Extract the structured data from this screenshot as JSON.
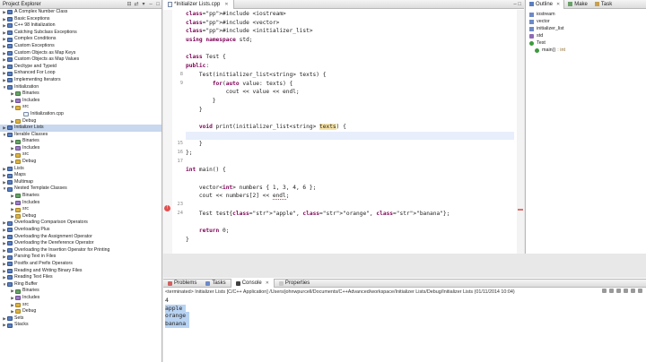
{
  "project_explorer": {
    "title": "Project Explorer",
    "items": [
      {
        "label": "A Complex Number Class",
        "depth": 0,
        "open": false,
        "kind": "project"
      },
      {
        "label": "Basic Exceptions",
        "depth": 0,
        "open": false,
        "kind": "project"
      },
      {
        "label": "C++ 98 Initialization",
        "depth": 0,
        "open": false,
        "kind": "project"
      },
      {
        "label": "Catching Subclass Exceptions",
        "depth": 0,
        "open": false,
        "kind": "project"
      },
      {
        "label": "Complex Conditions",
        "depth": 0,
        "open": false,
        "kind": "project"
      },
      {
        "label": "Custom Exceptions",
        "depth": 0,
        "open": false,
        "kind": "project"
      },
      {
        "label": "Custom Objects as Map Keys",
        "depth": 0,
        "open": false,
        "kind": "project"
      },
      {
        "label": "Custom Objects as Map Values",
        "depth": 0,
        "open": false,
        "kind": "project"
      },
      {
        "label": "Decltype and Typeid",
        "depth": 0,
        "open": false,
        "kind": "project"
      },
      {
        "label": "Enhanced For Loop",
        "depth": 0,
        "open": false,
        "kind": "project"
      },
      {
        "label": "Implementing Iterators",
        "depth": 0,
        "open": false,
        "kind": "project"
      },
      {
        "label": "Initialization",
        "depth": 0,
        "open": true,
        "kind": "project"
      },
      {
        "label": "Binaries",
        "depth": 1,
        "open": false,
        "kind": "bin"
      },
      {
        "label": "Includes",
        "depth": 1,
        "open": false,
        "kind": "inc"
      },
      {
        "label": "src",
        "depth": 1,
        "open": true,
        "kind": "folder"
      },
      {
        "label": "Initialization.cpp",
        "depth": 2,
        "open": false,
        "kind": "file"
      },
      {
        "label": "Debug",
        "depth": 1,
        "open": false,
        "kind": "folder"
      },
      {
        "label": "Initializer Lists",
        "depth": 0,
        "open": false,
        "kind": "project",
        "selected": true
      },
      {
        "label": "Iterable Classes",
        "depth": 0,
        "open": true,
        "kind": "project"
      },
      {
        "label": "Binaries",
        "depth": 1,
        "open": false,
        "kind": "bin"
      },
      {
        "label": "Includes",
        "depth": 1,
        "open": false,
        "kind": "inc"
      },
      {
        "label": "src",
        "depth": 1,
        "open": false,
        "kind": "folder"
      },
      {
        "label": "Debug",
        "depth": 1,
        "open": false,
        "kind": "folder"
      },
      {
        "label": "Lists",
        "depth": 0,
        "open": false,
        "kind": "project"
      },
      {
        "label": "Maps",
        "depth": 0,
        "open": false,
        "kind": "project"
      },
      {
        "label": "Multimap",
        "depth": 0,
        "open": false,
        "kind": "project"
      },
      {
        "label": "Nested Template Classes",
        "depth": 0,
        "open": true,
        "kind": "project"
      },
      {
        "label": "Binaries",
        "depth": 1,
        "open": false,
        "kind": "bin"
      },
      {
        "label": "Includes",
        "depth": 1,
        "open": false,
        "kind": "inc"
      },
      {
        "label": "src",
        "depth": 1,
        "open": false,
        "kind": "folder"
      },
      {
        "label": "Debug",
        "depth": 1,
        "open": false,
        "kind": "folder"
      },
      {
        "label": "Overloading Comparison Operators",
        "depth": 0,
        "open": false,
        "kind": "project"
      },
      {
        "label": "Overloading Plus",
        "depth": 0,
        "open": false,
        "kind": "project"
      },
      {
        "label": "Overloading the Assignment Operator",
        "depth": 0,
        "open": false,
        "kind": "project"
      },
      {
        "label": "Overloading the Dereference Operator",
        "depth": 0,
        "open": false,
        "kind": "project"
      },
      {
        "label": "Overloading the Insertion Operator for Printing",
        "depth": 0,
        "open": false,
        "kind": "project"
      },
      {
        "label": "Parsing Text in Files",
        "depth": 0,
        "open": false,
        "kind": "project"
      },
      {
        "label": "Postfix and Prefix Operators",
        "depth": 0,
        "open": false,
        "kind": "project"
      },
      {
        "label": "Reading and Writing Binary Files",
        "depth": 0,
        "open": false,
        "kind": "project"
      },
      {
        "label": "Reading Text Files",
        "depth": 0,
        "open": false,
        "kind": "project"
      },
      {
        "label": "Ring Buffer",
        "depth": 0,
        "open": true,
        "kind": "project"
      },
      {
        "label": "Binaries",
        "depth": 1,
        "open": false,
        "kind": "bin"
      },
      {
        "label": "Includes",
        "depth": 1,
        "open": false,
        "kind": "inc"
      },
      {
        "label": "src",
        "depth": 1,
        "open": false,
        "kind": "folder"
      },
      {
        "label": "Debug",
        "depth": 1,
        "open": false,
        "kind": "folder"
      },
      {
        "label": "Sets",
        "depth": 0,
        "open": false,
        "kind": "project"
      },
      {
        "label": "Stacks",
        "depth": 0,
        "open": false,
        "kind": "project"
      }
    ]
  },
  "editor": {
    "tab_label": "*Initializer Lists.cpp",
    "line_numbers": [
      "",
      "",
      "",
      "",
      "",
      "",
      "",
      "8",
      "9",
      "",
      "",
      "",
      "",
      "",
      "",
      "15",
      "16",
      "17",
      "",
      "",
      "",
      "",
      "23",
      "24",
      "",
      "",
      "",
      "",
      "",
      ""
    ],
    "lines": [
      "#include <iostream>",
      "#include <vector>",
      "#include <initializer_list>",
      "using namespace std;",
      "",
      "class Test {",
      "public:",
      "    Test(initializer_list<string> texts) {",
      "        for(auto value: texts) {",
      "            cout << value << endl;",
      "        }",
      "    }",
      "",
      "    void print(initializer_list<string> texts) {",
      "",
      "    }",
      "};",
      "",
      "int main() {",
      "",
      "    vector<int> numbers { 1, 3, 4, 6 };",
      "    cout << numbers[2] << endl;",
      "",
      "    Test test{\"apple\", \"orange\", \"banana\"};",
      "",
      "    return 0;",
      "}"
    ]
  },
  "outline": {
    "tabs": [
      "Outline",
      "Make",
      "Task"
    ],
    "items": [
      {
        "label": "iostream",
        "kind": "inc"
      },
      {
        "label": "vector",
        "kind": "inc"
      },
      {
        "label": "initializer_list",
        "kind": "inc"
      },
      {
        "label": "std",
        "kind": "ns"
      },
      {
        "label": "Test",
        "kind": "cls"
      },
      {
        "label": "main()",
        "kind": "fn",
        "type": ": int"
      }
    ]
  },
  "console": {
    "tabs": [
      "Problems",
      "Tasks",
      "Console",
      "Properties"
    ],
    "active_tab": "Console",
    "header": "<terminated> Initializer Lists [C/C++ Application] /Users/johnwpurcell/Documents/C++Advanced/workspace/Initializer Lists/Debug/Initializer Lists (01/11/2014 10:04)",
    "output": [
      "4",
      "apple",
      "orange",
      "banana"
    ]
  },
  "colors": {
    "keyword": "#7f0055",
    "string": "#2a00ff",
    "selection": "#b8d3f2",
    "current_line": "#e8eefb"
  }
}
